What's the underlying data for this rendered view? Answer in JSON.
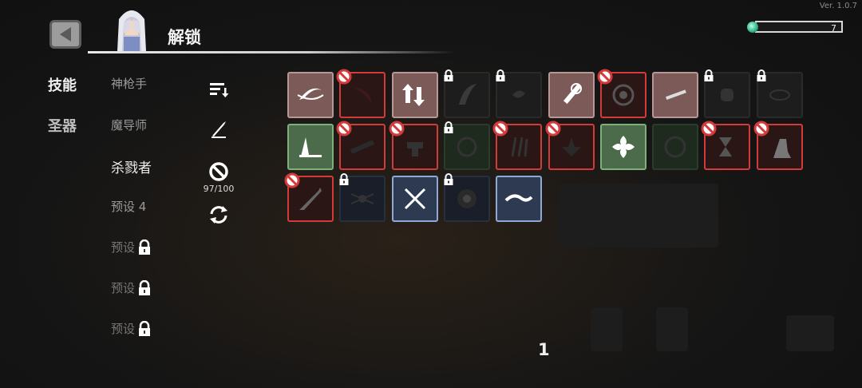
{
  "version": "Ver. 1.0.7",
  "header": {
    "title": "解锁"
  },
  "currency": {
    "count": "7"
  },
  "categories": [
    {
      "label": "技能",
      "active": true
    },
    {
      "label": "圣器",
      "active": false
    }
  ],
  "presets": [
    {
      "label": "神枪手",
      "state": "dim"
    },
    {
      "label": "魔导师",
      "state": "dim"
    },
    {
      "label": "杀戮者",
      "state": "active"
    },
    {
      "label": "预设 4",
      "state": "dim"
    },
    {
      "label": "预设",
      "state": "locked"
    },
    {
      "label": "预设",
      "state": "locked"
    },
    {
      "label": "预设",
      "state": "locked"
    }
  ],
  "tools": {
    "sort_icon": "sort-icon",
    "edit_icon": "edit-icon",
    "ban_icon": "ban-icon",
    "ban_count": "97/100",
    "refresh_icon": "refresh-icon"
  },
  "skills": [
    [
      {
        "style": "red-light",
        "banned": false,
        "locked": false,
        "icon": "slash-arc"
      },
      {
        "style": "red",
        "banned": true,
        "locked": false,
        "icon": "crescent-blade"
      },
      {
        "style": "red-light",
        "banned": false,
        "locked": false,
        "icon": "arrows-swap"
      },
      {
        "style": "dark",
        "banned": false,
        "locked": true,
        "icon": "claw-slash"
      },
      {
        "style": "dark",
        "banned": false,
        "locked": true,
        "icon": "spin-blade"
      },
      {
        "style": "red-light",
        "banned": false,
        "locked": false,
        "icon": "frost-sword"
      },
      {
        "style": "red",
        "banned": true,
        "locked": false,
        "icon": "target-ring"
      },
      {
        "style": "red-light",
        "banned": false,
        "locked": false,
        "icon": "blood-blade"
      },
      {
        "style": "dark",
        "banned": false,
        "locked": true,
        "icon": "gauntlet"
      },
      {
        "style": "dark",
        "banned": false,
        "locked": true,
        "icon": "chain-whirl"
      }
    ],
    [
      {
        "style": "green-light",
        "banned": false,
        "locked": false,
        "icon": "ground-slash"
      },
      {
        "style": "red",
        "banned": true,
        "locked": false,
        "icon": "thorn-chain"
      },
      {
        "style": "red",
        "banned": true,
        "locked": false,
        "icon": "anvil"
      },
      {
        "style": "green",
        "banned": false,
        "locked": true,
        "icon": "chakram"
      },
      {
        "style": "red",
        "banned": true,
        "locked": false,
        "icon": "triple-daggers"
      },
      {
        "style": "red",
        "banned": true,
        "locked": false,
        "icon": "shatter"
      },
      {
        "style": "green-light",
        "banned": false,
        "locked": false,
        "icon": "shuriken-swirl"
      },
      {
        "style": "green",
        "banned": false,
        "locked": false,
        "icon": "compass-ring"
      },
      {
        "style": "red",
        "banned": true,
        "locked": false,
        "icon": "hourglass-up"
      },
      {
        "style": "red",
        "banned": true,
        "locked": false,
        "icon": "boot-kick"
      }
    ],
    [
      {
        "style": "red",
        "banned": true,
        "locked": false,
        "icon": "dash-arrow"
      },
      {
        "style": "blue",
        "banned": false,
        "locked": true,
        "icon": "spider-rune"
      },
      {
        "style": "blue-light",
        "banned": false,
        "locked": false,
        "icon": "crossed-swords"
      },
      {
        "style": "blue",
        "banned": false,
        "locked": true,
        "icon": "vortex"
      },
      {
        "style": "blue-light",
        "banned": false,
        "locked": false,
        "icon": "wind-wave"
      }
    ]
  ],
  "pagination": {
    "page": "1"
  }
}
